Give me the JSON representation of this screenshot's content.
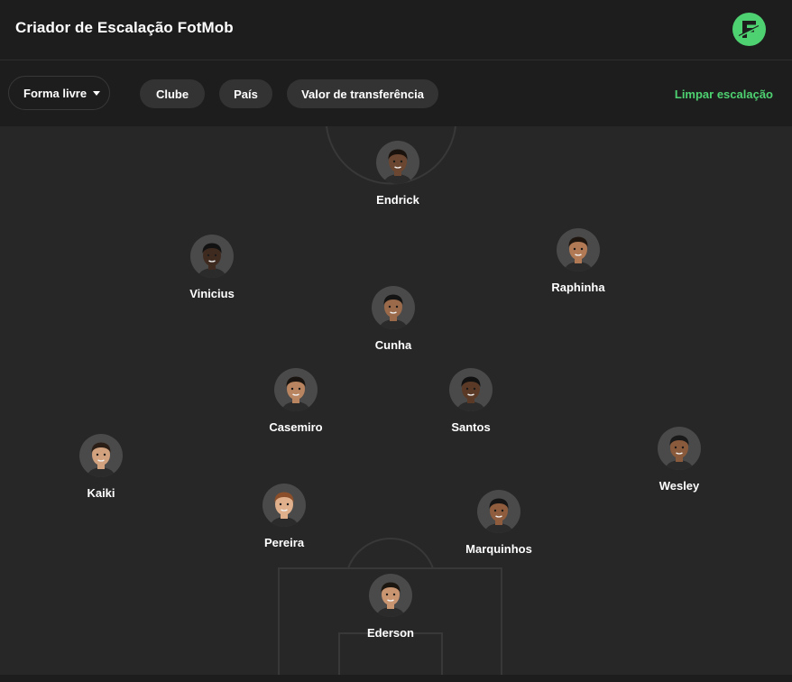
{
  "header": {
    "title": "Criador de Escalação FotMob",
    "logo_icon": "fotmob-logo-icon",
    "brand_color": "#4ed271"
  },
  "toolbar": {
    "formation_dropdown": {
      "label": "Forma livre",
      "icon": "caret-down-icon"
    },
    "filters": [
      {
        "label": "Clube"
      },
      {
        "label": "País"
      },
      {
        "label": "Valor de transferência"
      }
    ],
    "clear_label": "Limpar escalação",
    "accent_color": "#4ed271"
  },
  "players": [
    {
      "name": "Endrick",
      "skin": "#6b4630",
      "hair": "#1a120d"
    },
    {
      "name": "Vinicius",
      "skin": "#3f2a1f",
      "hair": "#121212"
    },
    {
      "name": "Raphinha",
      "skin": "#b17a55",
      "hair": "#1f1610"
    },
    {
      "name": "Cunha",
      "skin": "#9a6a4a",
      "hair": "#141414"
    },
    {
      "name": "Casemiro",
      "skin": "#b98560",
      "hair": "#1a1410"
    },
    {
      "name": "Santos",
      "skin": "#5a3a26",
      "hair": "#111111"
    },
    {
      "name": "Kaiki",
      "skin": "#d2a27e",
      "hair": "#2a1e16"
    },
    {
      "name": "Wesley",
      "skin": "#8a5a3c",
      "hair": "#1a1a1a"
    },
    {
      "name": "Pereira",
      "skin": "#e0b08c",
      "hair": "#8a4f2a"
    },
    {
      "name": "Marquinhos",
      "skin": "#8f5d3d",
      "hair": "#151515"
    },
    {
      "name": "Ederson",
      "skin": "#c99470",
      "hair": "#1c1611"
    }
  ]
}
